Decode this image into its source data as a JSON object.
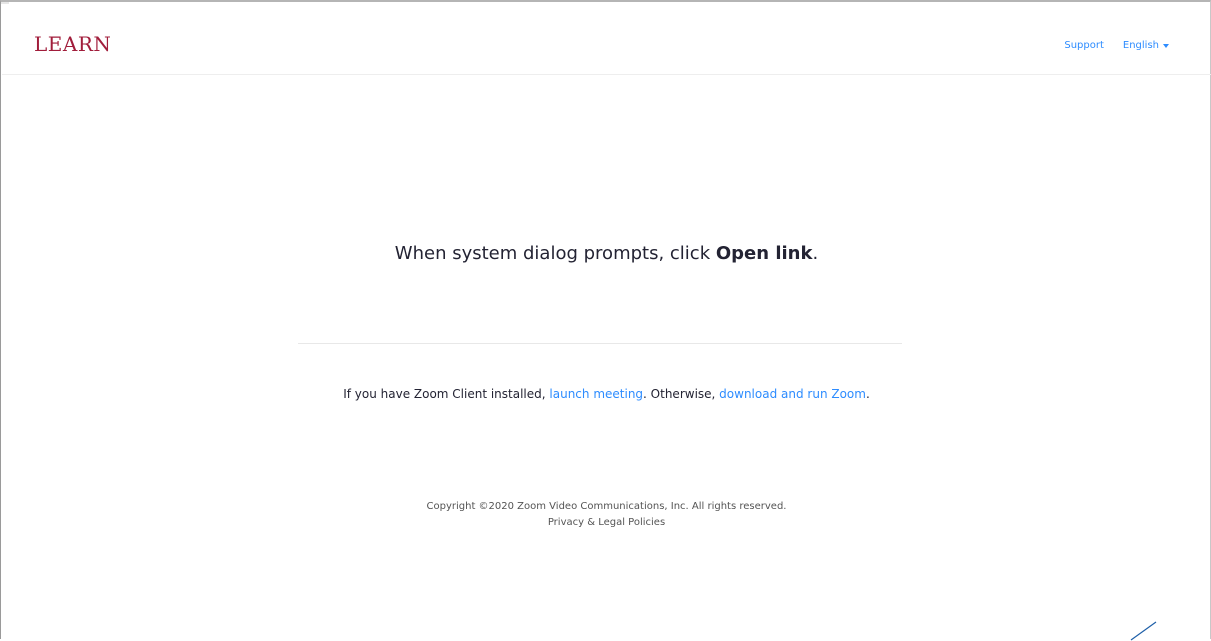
{
  "header": {
    "logo_text": "LEARN",
    "support_label": "Support",
    "language_label": "English"
  },
  "main": {
    "prompt_prefix": "When system dialog prompts, click ",
    "prompt_bold": "Open link",
    "prompt_suffix": ".",
    "install_prefix": "If you have Zoom Client installed, ",
    "launch_link": "launch meeting",
    "install_middle": ". Otherwise, ",
    "download_link": "download and run Zoom",
    "install_suffix": "."
  },
  "footer": {
    "copyright": "Copyright ©2020 Zoom Video Communications, Inc. All rights reserved.",
    "legal_link": "Privacy & Legal Policies"
  },
  "colors": {
    "brand": "#a11d3b",
    "link": "#2d8cff",
    "text": "#232333"
  },
  "icons": {
    "language_caret": "caret-down-icon"
  }
}
